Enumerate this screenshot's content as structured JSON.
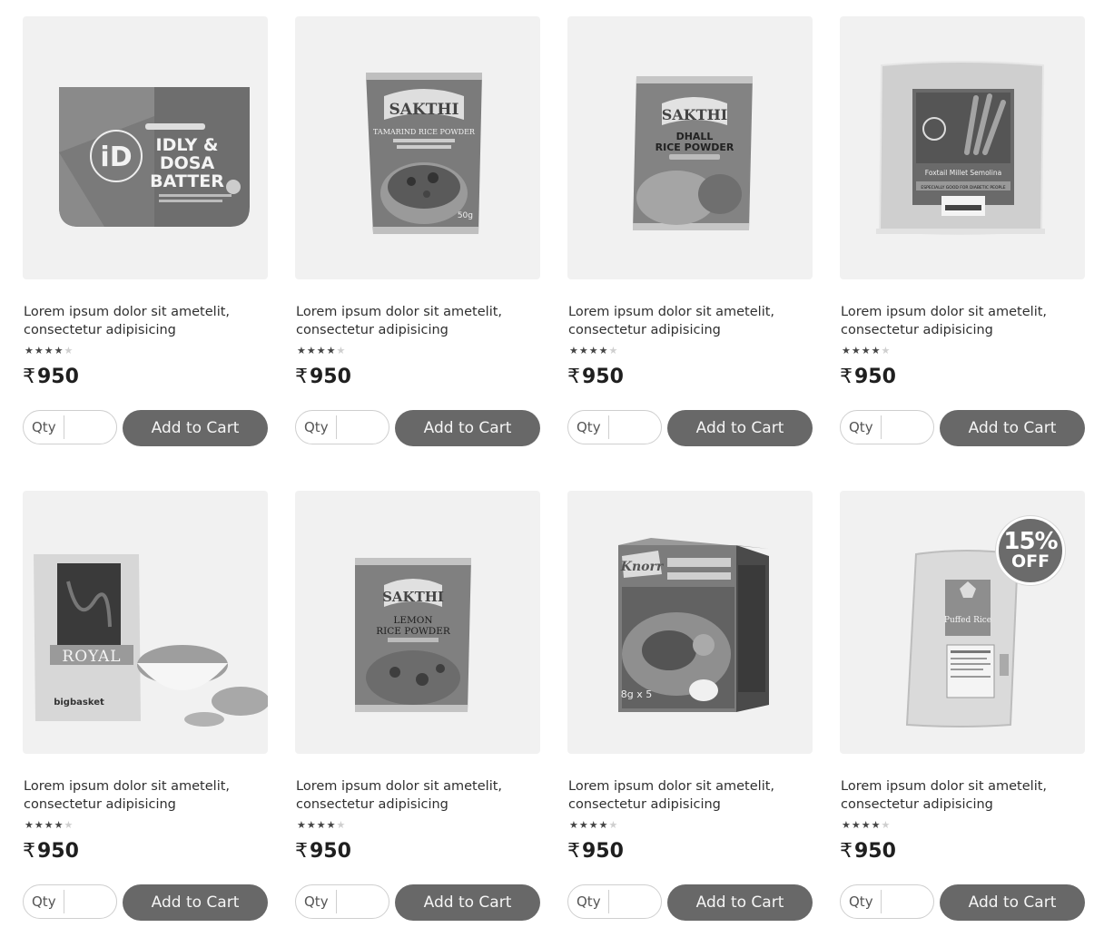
{
  "currency_symbol": "₹",
  "qty_label": "Qty",
  "add_to_cart_label": "Add to Cart",
  "products": [
    {
      "title_line1": "Lorem ipsum dolor sit ametelit,",
      "title_line2": "consectetur adipisicing",
      "rating": 4,
      "rating_max": 5,
      "price": "950",
      "image": "idly-dosa-batter-pouch",
      "image_text": [
        "iD",
        "IDLY &",
        "DOSA",
        "BATTER"
      ]
    },
    {
      "title_line1": "Lorem ipsum dolor sit ametelit,",
      "title_line2": "consectetur adipisicing",
      "rating": 4,
      "rating_max": 5,
      "price": "950",
      "image": "sakthi-tamarind-rice-powder",
      "image_text": [
        "SAKTHI",
        "TAMARIND RICE POWDER",
        "50g"
      ]
    },
    {
      "title_line1": "Lorem ipsum dolor sit ametelit,",
      "title_line2": "consectetur adipisicing",
      "rating": 4,
      "rating_max": 5,
      "price": "950",
      "image": "sakthi-dhall-rice-powder",
      "image_text": [
        "SAKTHI",
        "DHALL",
        "RICE POWDER"
      ]
    },
    {
      "title_line1": "Lorem ipsum dolor sit ametelit,",
      "title_line2": "consectetur adipisicing",
      "rating": 4,
      "rating_max": 5,
      "price": "950",
      "image": "foxtail-millet-semolina",
      "image_text": [
        "Foxtail Millet Semolina",
        "ESPECIALLY GOOD FOR DIABETIC PEOPLE"
      ]
    },
    {
      "title_line1": "Lorem ipsum dolor sit ametelit,",
      "title_line2": "consectetur adipisicing",
      "rating": 4,
      "rating_max": 5,
      "price": "950",
      "image": "royal-lentils-bag",
      "image_text": [
        "ROYAL",
        "bigbasket"
      ]
    },
    {
      "title_line1": "Lorem ipsum dolor sit ametelit,",
      "title_line2": "consectetur adipisicing",
      "rating": 4,
      "rating_max": 5,
      "price": "950",
      "image": "sakthi-lemon-rice-powder",
      "image_text": [
        "SAKTHI",
        "LEMON",
        "RICE POWDER"
      ]
    },
    {
      "title_line1": "Lorem ipsum dolor sit ametelit,",
      "title_line2": "consectetur adipisicing",
      "rating": 4,
      "rating_max": 5,
      "price": "950",
      "image": "knorr-spice-box",
      "image_text": [
        "Knorr",
        "8g x 5"
      ]
    },
    {
      "title_line1": "Lorem ipsum dolor sit ametelit,",
      "title_line2": "consectetur adipisicing",
      "rating": 4,
      "rating_max": 5,
      "price": "950",
      "image": "puffed-rice-bag",
      "image_text": [
        "Puffed Rice"
      ],
      "badge": {
        "percent": "15%",
        "label": "OFF"
      }
    }
  ]
}
